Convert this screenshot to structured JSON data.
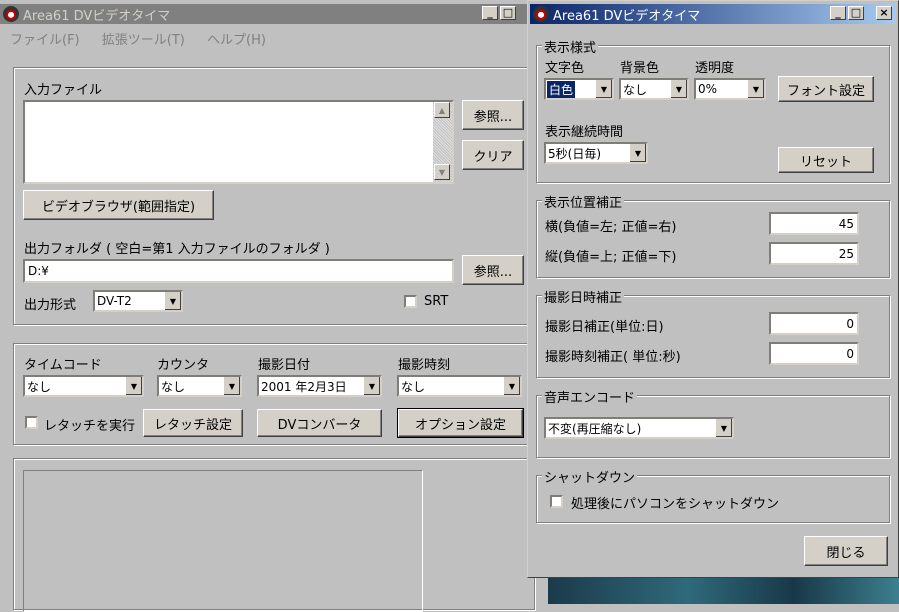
{
  "main_window": {
    "title": "Area61  DVビデオタイマ",
    "menu": [
      "ファイル(F)",
      "拡張ツール(T)",
      "ヘルプ(H)"
    ],
    "input_file_label": "入力ファイル",
    "browse_label": "参照...",
    "clear_label": "クリア",
    "video_browser_label": "ビデオブラウザ(範囲指定)",
    "output_folder_label": "出力フォルダ ( 空白=第1 入力ファイルのフォルダ )",
    "output_folder_value": "D:¥",
    "output_browse_label": "参照...",
    "output_format_label": "出力形式",
    "output_format_value": "DV-T2",
    "srt_label": "SRT",
    "timecode_label": "タイムコード",
    "timecode_value": "なし",
    "counter_label": "カウンタ",
    "counter_value": "なし",
    "shoot_date_label": "撮影日付",
    "shoot_date_value": "2001 年2月3日",
    "shoot_time_label": "撮影時刻",
    "shoot_time_value": "なし",
    "retouch_run_label": "レタッチを実行",
    "retouch_settings_label": "レタッチ設定",
    "dv_converter_label": "DVコンバータ",
    "option_settings_label": "オプション設定"
  },
  "dialog": {
    "title": "Area61  DVビデオタイマ",
    "display_style": {
      "group_label": "表示様式",
      "text_color_label": "文字色",
      "text_color_value": "白色",
      "bg_color_label": "背景色",
      "bg_color_value": "なし",
      "opacity_label": "透明度",
      "opacity_value": "0%",
      "font_settings_label": "フォント設定",
      "duration_label": "表示継続時間",
      "duration_value": "5秒(日毎)",
      "reset_label": "リセット"
    },
    "position": {
      "group_label": "表示位置補正",
      "horizontal_label": "横(負値=左; 正値=右)",
      "horizontal_value": "45",
      "vertical_label": "縦(負値=上; 正値=下)",
      "vertical_value": "25"
    },
    "datetime": {
      "group_label": "撮影日時補正",
      "date_label": "撮影日補正(単位:日)",
      "date_value": "0",
      "time_label": "撮影時刻補正( 単位:秒)",
      "time_value": "0"
    },
    "audio": {
      "group_label": "音声エンコード",
      "value": "不変(再圧縮なし)"
    },
    "shutdown": {
      "group_label": "シャットダウン",
      "checkbox_label": "処理後にパソコンをシャットダウン"
    },
    "close_label": "閉じる"
  }
}
